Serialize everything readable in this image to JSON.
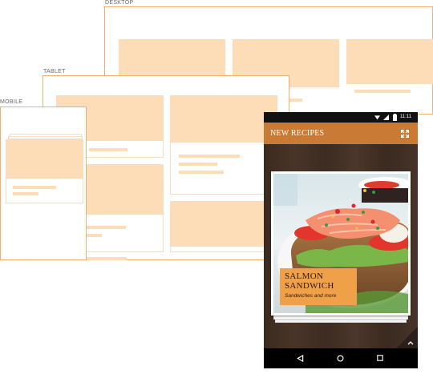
{
  "labels": {
    "desktop": "DESKTOP",
    "tablet": "TABLET",
    "mobile": "MOBILE"
  },
  "phone": {
    "status": {
      "time": "11:11"
    },
    "appbar": {
      "title": "NEW RECIPES",
      "expand_icon": "expand-icon"
    },
    "card": {
      "title_line1": "SALMON",
      "title_line2": "SANDWICH",
      "subtitle": "Sandwiches and more"
    },
    "nav": {
      "back": "back-icon",
      "home": "home-icon",
      "recents": "recents-icon"
    },
    "scroll_up_icon": "chevron-up-icon"
  },
  "colors": {
    "placeholder": "#fddcb8",
    "frame_border": "#f1b070",
    "appbar": "#c97b35",
    "badge": "#f0a048",
    "wood": "#3f2d23"
  }
}
